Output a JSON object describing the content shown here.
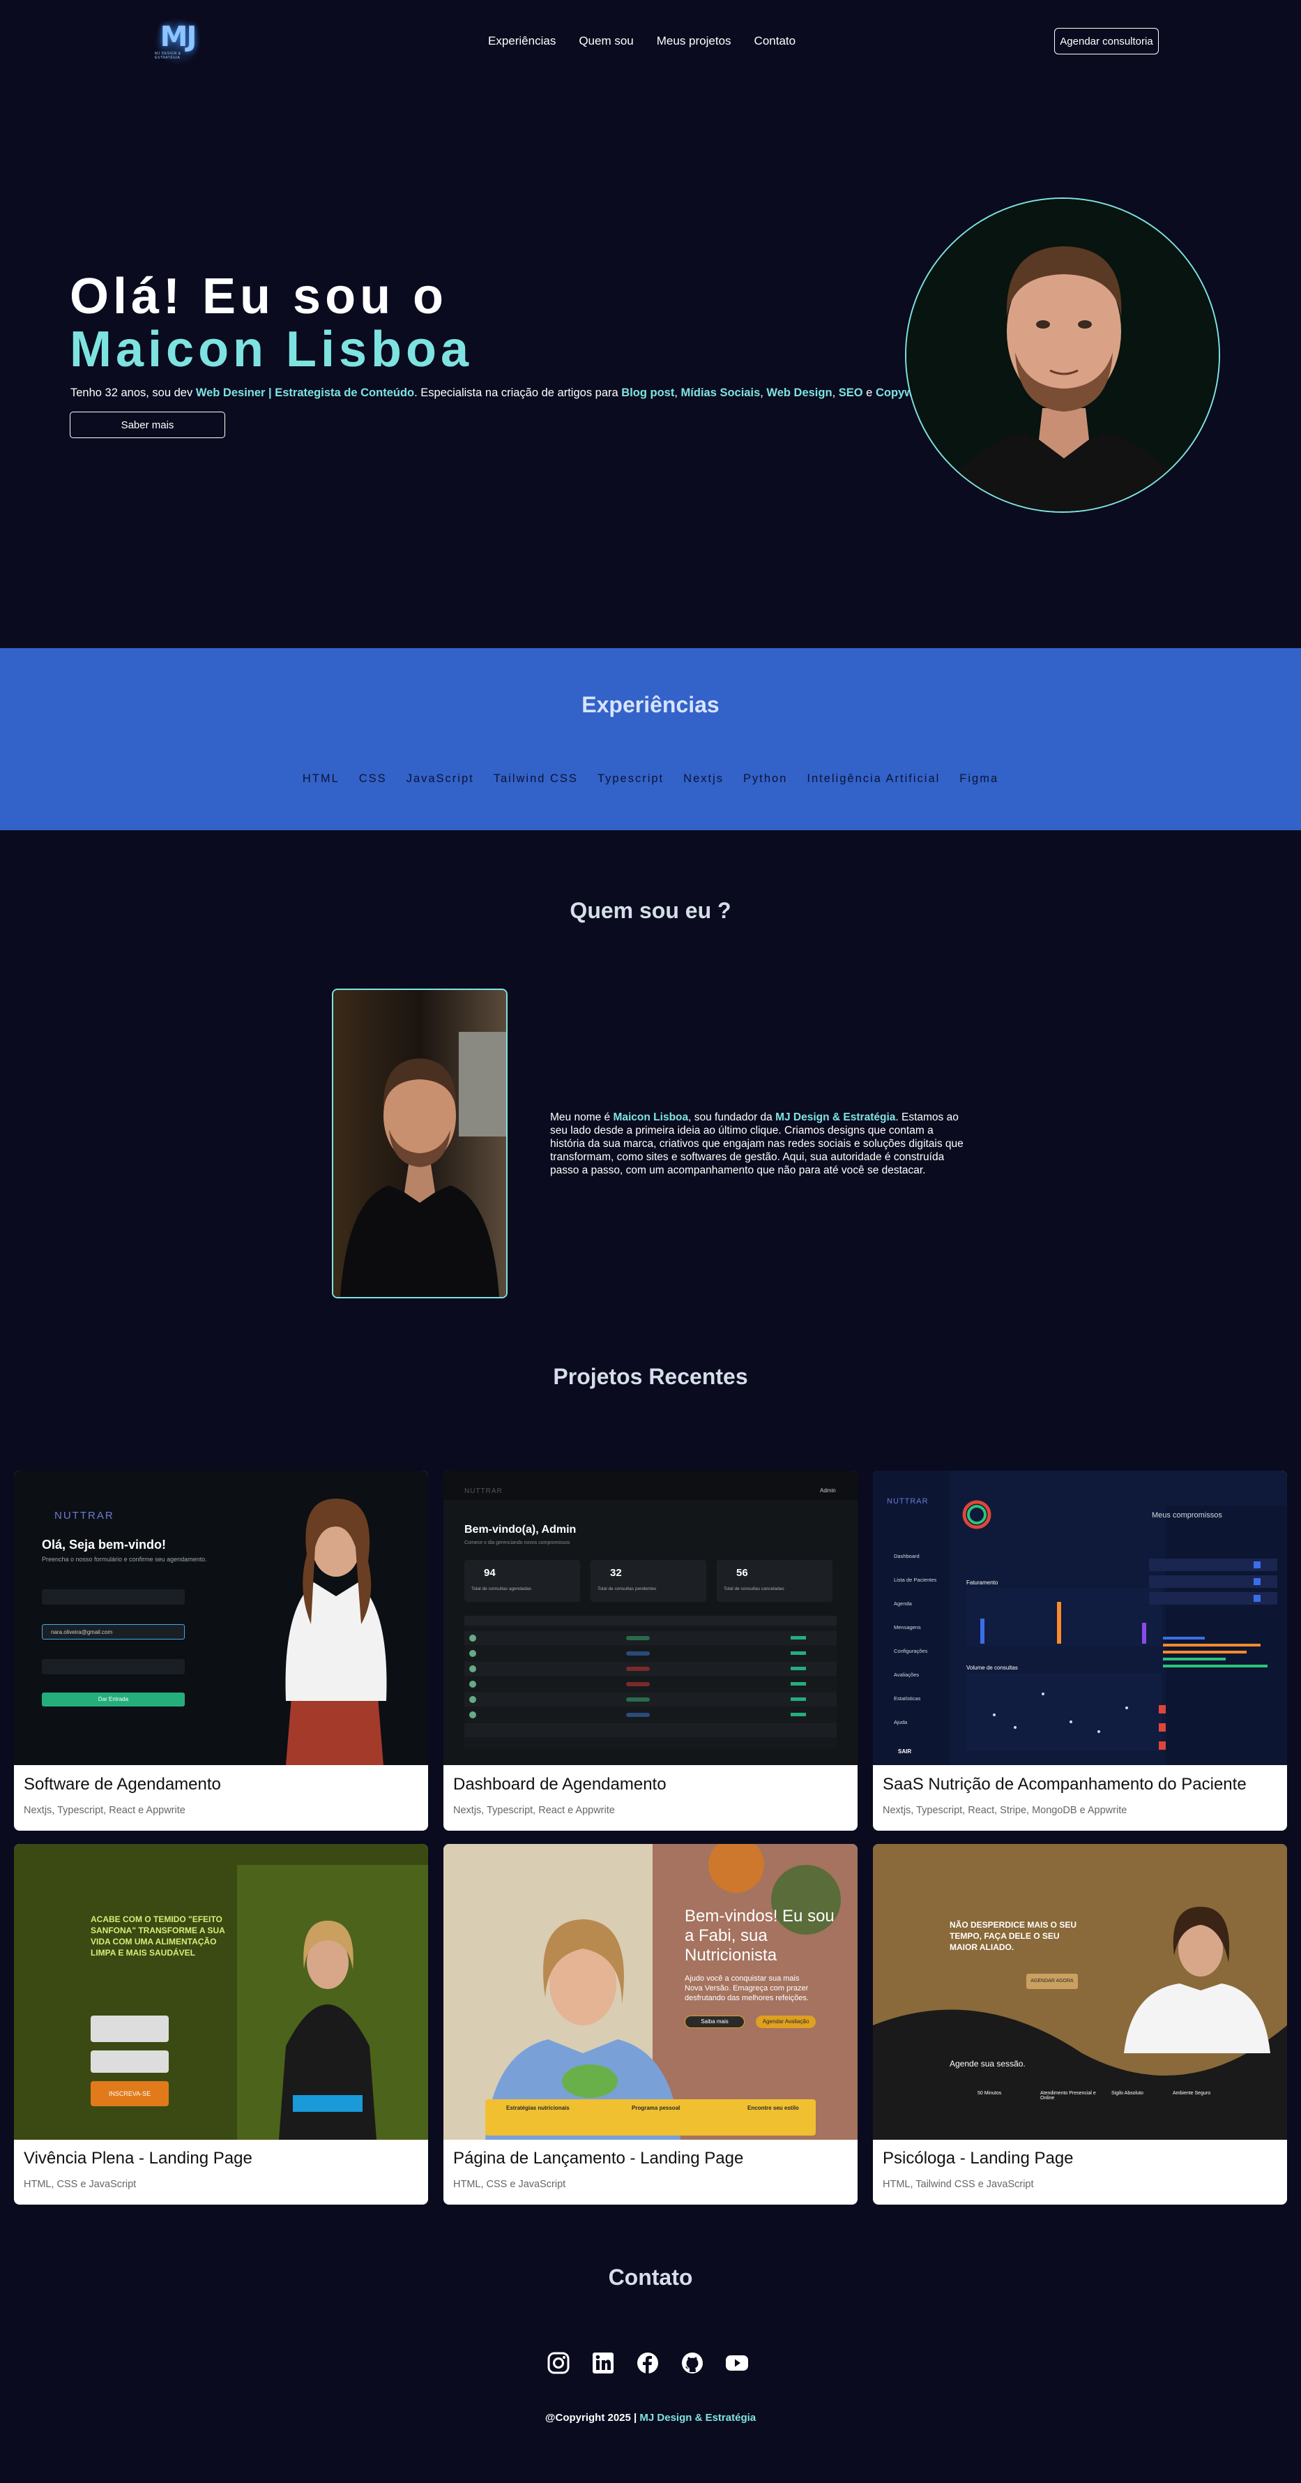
{
  "header": {
    "logo_text": "MJ",
    "logo_sub": "MJ DESIGN & ESTRATÉGIA",
    "nav": [
      "Experiências",
      "Quem sou",
      "Meus projetos",
      "Contato"
    ],
    "cta": "Agendar consultoria"
  },
  "hero": {
    "line1": "Olá! Eu sou o",
    "line2": "Maicon Lisboa",
    "desc_1": "Tenho 32 anos, sou dev ",
    "desc_hl1": "Web Desiner | Estrategista de Conteúdo",
    "desc_2": ". Especialista na criação de artigos para ",
    "desc_hl2": "Blog post",
    "desc_3": ", ",
    "desc_hl3": "Mídias Sociais",
    "desc_4": ", ",
    "desc_hl4": "Web Design",
    "desc_5": ", ",
    "desc_hl5": "SEO",
    "desc_6": " e ",
    "desc_hl6": "Copywriter",
    "desc_7": ".",
    "button": "Saber mais"
  },
  "experiences": {
    "title": "Experiências",
    "skills": [
      "HTML",
      "CSS",
      "JavaScript",
      "Tailwind CSS",
      "Typescript",
      "Nextjs",
      "Python",
      "Inteligência Artificial",
      "Figma"
    ]
  },
  "about": {
    "title": "Quem sou eu ?",
    "t1": "Meu nome é ",
    "hl1": "Maicon Lisboa",
    "t2": ", sou fundador da ",
    "hl2": "MJ Design & Estratégia",
    "t3": ". Estamos ao seu lado desde a primeira ideia ao último clique. Criamos designs que contam a história da sua marca, criativos que engajam nas redes sociais e soluções digitais que transformam, como sites e softwares de gestão. Aqui, sua autoridade é construída passo a passo, com um acompanhamento que não para até você se destacar."
  },
  "projects": {
    "title": "Projetos Recentes",
    "items": [
      {
        "title": "Software de Agendamento",
        "stack": "Nextjs, Typescript, React e Appwrite"
      },
      {
        "title": "Dashboard de Agendamento",
        "stack": "Nextjs, Typescript, React e Appwrite"
      },
      {
        "title": "SaaS Nutrição de Acompanhamento do Paciente",
        "stack": "Nextjs, Typescript, React, Stripe, MongoDB e Appwrite"
      },
      {
        "title": "Vivência Plena - Landing Page",
        "stack": "HTML, CSS e JavaScript"
      },
      {
        "title": "Página de Lançamento - Landing Page",
        "stack": "HTML, CSS e JavaScript"
      },
      {
        "title": "Psicóloga - Landing Page",
        "stack": "HTML, Tailwind CSS e JavaScript"
      }
    ],
    "mock": {
      "nuttrar": "NUTTRAR",
      "welcome": "Olá, Seja bem-vindo!",
      "welcome_sub": "Preencha o nosso formulário e confirme seu agendamento.",
      "email": "nara.oliveira@gmail.com",
      "btn": "Dar Entrada",
      "dash_welcome": "Bem-vindo(a), Admin",
      "dash_sub": "Comece o dia gerenciando novos compromissos",
      "admin": "Admin",
      "stat1": "94",
      "stat1_l": "Total de consultas agendadas",
      "stat2": "32",
      "stat2_l": "Total de consultas pendentes",
      "stat3": "56",
      "stat3_l": "Total de consultas canceladas",
      "saas_menu": [
        "Dashboard",
        "Lista de Pacientes",
        "Agenda",
        "Mensagens",
        "Configurações",
        "Avaliações",
        "Estatísticas",
        "Ajuda"
      ],
      "saas_sair": "SAIR",
      "saas_fat": "Faturamento",
      "saas_vol": "Volume de consultas",
      "saas_comp": "Meus compromissos",
      "vp_headline": "ACABE COM O TEMIDO \"EFEITO SANFONA\" TRANSFORME A SUA VIDA COM UMA ALIMENTAÇÃO LIMPA E MAIS SAUDÁVEL",
      "vp_btn": "INSCREVA-SE",
      "fabi_h": "Bem-vindos! Eu sou a Fabi, sua Nutricionista",
      "fabi_p": "Ajudo você a conquistar sua mais Nova Versão. Emagreça com prazer desfrutando das melhores refeições.",
      "fabi_b1": "Saiba mais",
      "fabi_b2": "Agendar Avaliação",
      "fabi_f1": "Estratégias nutricionais",
      "fabi_f2": "Programa pessoal",
      "fabi_f3": "Encontre seu estilo",
      "psi_h": "NÃO DESPERDICE MAIS O SEU TEMPO, FAÇA DELE O SEU MAIOR ALIADO.",
      "psi_btn": "AGENDAR AGORA",
      "psi_agende": "Agende sua sessão.",
      "psi_i1": "50 Minutos",
      "psi_i2": "Atendimento Presencial e Online",
      "psi_i3": "Sigilo Absoluto",
      "psi_i4": "Ambiente Seguro"
    }
  },
  "contact": {
    "title": "Contato",
    "copyright_1": "@Copyright 2025 | ",
    "copyright_hl": "MJ Design & Estratégia"
  },
  "colors": {
    "bg": "#0a0b1e",
    "accent": "#7ee3e0",
    "band": "#3362c9"
  }
}
